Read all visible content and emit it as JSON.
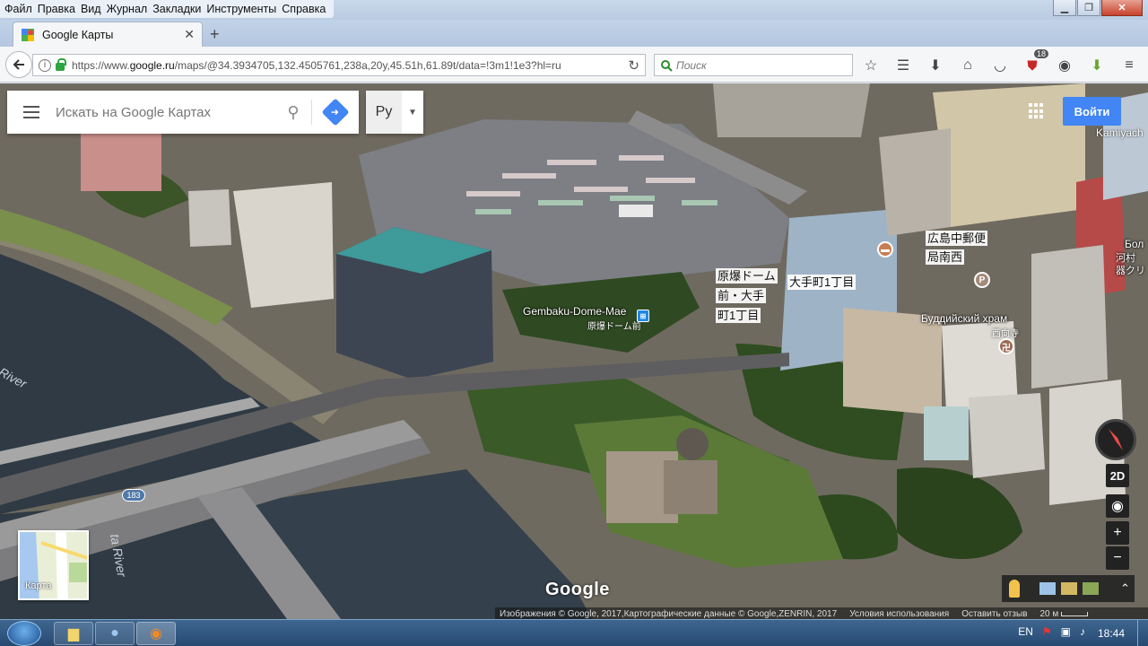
{
  "window": {
    "menu": [
      "Файл",
      "Правка",
      "Вид",
      "Журнал",
      "Закладки",
      "Инструменты",
      "Справка"
    ]
  },
  "browser": {
    "tab_title": "Google Карты",
    "new_tab": "+",
    "url_prefix": "https://www.",
    "url_domain": "google.ru",
    "url_rest": "/maps/@34.3934705,132.4505761,238a,20y,45.51h,61.89t/data=!3m1!1e3?hl=ru",
    "search_placeholder": "Поиск",
    "addon_badge": "18"
  },
  "map": {
    "search_placeholder": "Искать на Google Картах",
    "language": "Ру",
    "signin": "Войти",
    "edge_label": "Kamiyach",
    "labels": {
      "dome_stop_1": "原爆ドーム",
      "dome_stop_2": "前・大手",
      "dome_stop_3": "町1丁目",
      "otemachi": "大手町1丁目",
      "post_1": "広島中郵便",
      "post_2": "局南西",
      "edge_jp_1": "Бол",
      "edge_jp_2": "河村",
      "edge_jp_3": "器クリ"
    },
    "poi": {
      "gembaku_en": "Gembaku-Dome-Mae",
      "gembaku_jp": "原爆ドーム前",
      "temple_ru": "Буддийский храм",
      "temple_jp": "西向寺",
      "parking": "P"
    },
    "rivers": [
      "River",
      "ta River"
    ],
    "road_badge": "183",
    "minimap_label": "Карта",
    "btn_2d": "2D",
    "zoom_in": "+",
    "zoom_out": "−",
    "logo": "Google",
    "attribution": "Изображения © Google, 2017,Картографические данные © Google,ZENRIN, 2017",
    "terms": "Условия использования",
    "feedback": "Оставить отзыв",
    "scale": "20 м"
  },
  "taskbar": {
    "lang": "EN",
    "time": "18:44"
  }
}
